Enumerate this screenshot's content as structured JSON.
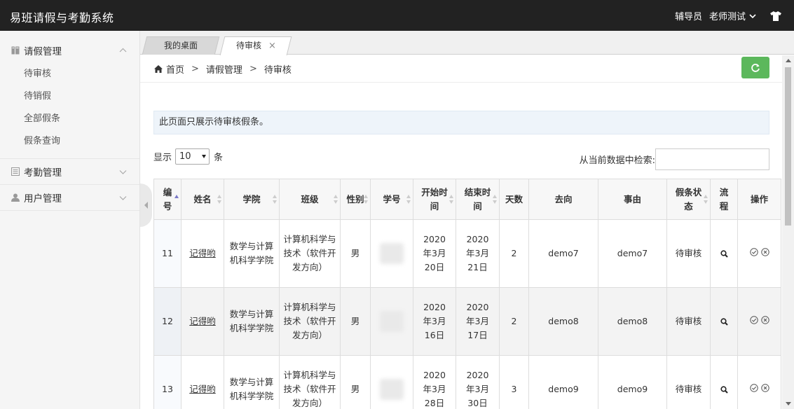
{
  "app": {
    "title": "易班请假与考勤系统",
    "role": "辅导员",
    "user": "老师测试"
  },
  "sidebar": {
    "groups": [
      {
        "label": "请假管理",
        "icon": "leave-icon",
        "expanded": true,
        "items": [
          "待审核",
          "待销假",
          "全部假条",
          "假条查询"
        ]
      },
      {
        "label": "考勤管理",
        "icon": "attendance-icon",
        "expanded": false
      },
      {
        "label": "用户管理",
        "icon": "user-icon",
        "expanded": false
      }
    ]
  },
  "tabs": [
    {
      "label": "我的桌面",
      "active": false
    },
    {
      "label": "待审核",
      "active": true,
      "close": "×"
    }
  ],
  "breadcrumb": [
    "首页",
    "请假管理",
    "待审核"
  ],
  "breadcrumb_sep": ">",
  "info_text": "此页面只展示待审核假条。",
  "length": {
    "prefix": "显示",
    "value": "10",
    "suffix": "条"
  },
  "search": {
    "label": "从当前数据中检索:",
    "value": ""
  },
  "table": {
    "headers": [
      "编号",
      "姓名",
      "学院",
      "班级",
      "性别",
      "学号",
      "开始时间",
      "结束时间",
      "天数",
      "去向",
      "事由",
      "假条状态",
      "流程",
      "操作"
    ],
    "rows": [
      {
        "id": "11",
        "name": "记得哟",
        "college": "数学与计算机科学学院",
        "class": "计算机科学与技术（软件开发方向）",
        "gender": "男",
        "start": "2020年3月20日",
        "end": "2020年3月21日",
        "days": "2",
        "dest": "demo7",
        "reason": "demo7",
        "status": "待审核"
      },
      {
        "id": "12",
        "name": "记得哟",
        "college": "数学与计算机科学学院",
        "class": "计算机科学与技术（软件开发方向）",
        "gender": "男",
        "start": "2020年3月16日",
        "end": "2020年3月17日",
        "days": "2",
        "dest": "demo8",
        "reason": "demo8",
        "status": "待审核"
      },
      {
        "id": "13",
        "name": "记得哟",
        "college": "数学与计算机科学学院",
        "class": "计算机科学与技术（软件开发方向）",
        "gender": "男",
        "start": "2020年3月28日",
        "end": "2020年3月30日",
        "days": "3",
        "dest": "demo9",
        "reason": "demo9",
        "status": "待审核"
      }
    ]
  },
  "colors": {
    "topbar": "#222222",
    "refresh": "#5cb85c",
    "info_bg": "#eef4fa",
    "sort_active": "#7a79c8"
  }
}
